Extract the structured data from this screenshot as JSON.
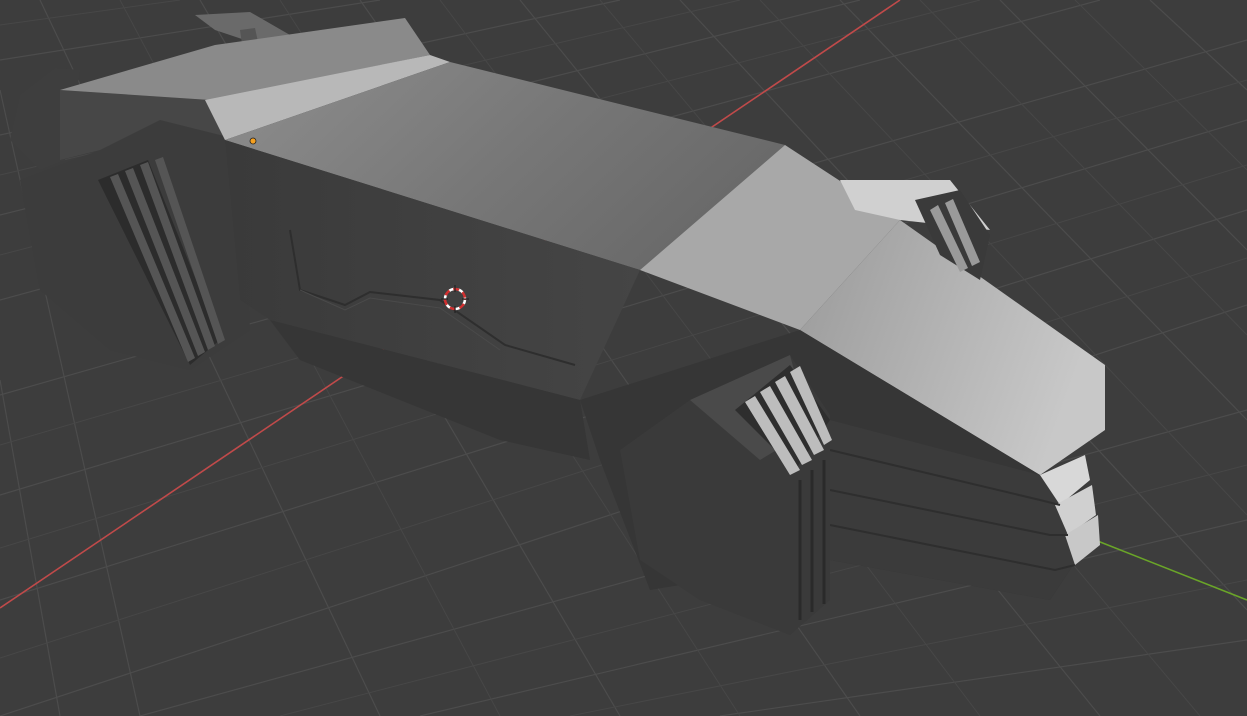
{
  "viewport": {
    "background_color": "#3d3d3d",
    "grid_line_color": "#4c4c4c",
    "x_axis_color": "#c04a4a",
    "y_axis_color": "#6aa528",
    "object_light_color": "#c8c8c8",
    "object_mid_color": "#8a8a8a",
    "object_dark_color": "#3a3a3a",
    "origin_dot_color": "#f5a020",
    "cursor_color": "#d03030"
  },
  "icons": {
    "cursor": "3d-cursor-icon",
    "origin": "object-origin-icon"
  }
}
